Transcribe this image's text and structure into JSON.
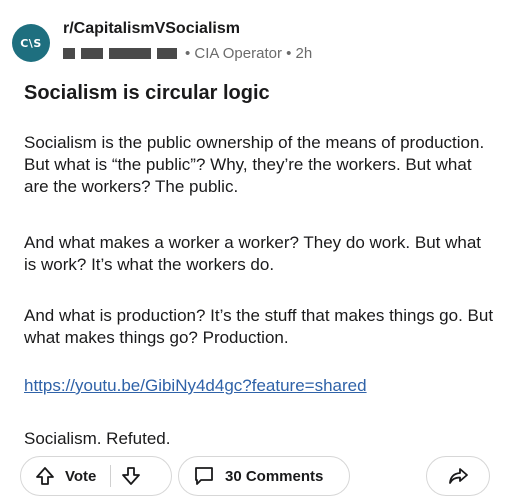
{
  "post": {
    "avatar_text": "C\\S",
    "subreddit": "r/CapitalismVSocialism",
    "author": "CIA Operator",
    "age": "2h",
    "meta": "• CIA Operator • 2h",
    "title": "Socialism is circular logic",
    "paragraph1": "Socialism is the public ownership of the means of production. But what is “the public”? Why, they’re the workers. But what are the workers? The public.",
    "paragraph2": "And what makes a worker a worker? They do work. But what is work? It’s what the workers do.",
    "paragraph3": "And what is production? It’s the stuff that makes things go. But what makes things go? Production.",
    "link": "https://youtu.be/GibiNy4d4gc?feature=shared",
    "closing": "Socialism. Refuted."
  },
  "actions": {
    "vote_label": "Vote",
    "comments_label": "30 Comments"
  },
  "colors": {
    "avatar_bg": "#1e6f7f",
    "link": "#2f62a8",
    "text": "#1a1a1b",
    "meta": "#6b6b6b"
  },
  "icons": [
    "upvote-icon",
    "downvote-icon",
    "comment-icon",
    "share-icon"
  ]
}
